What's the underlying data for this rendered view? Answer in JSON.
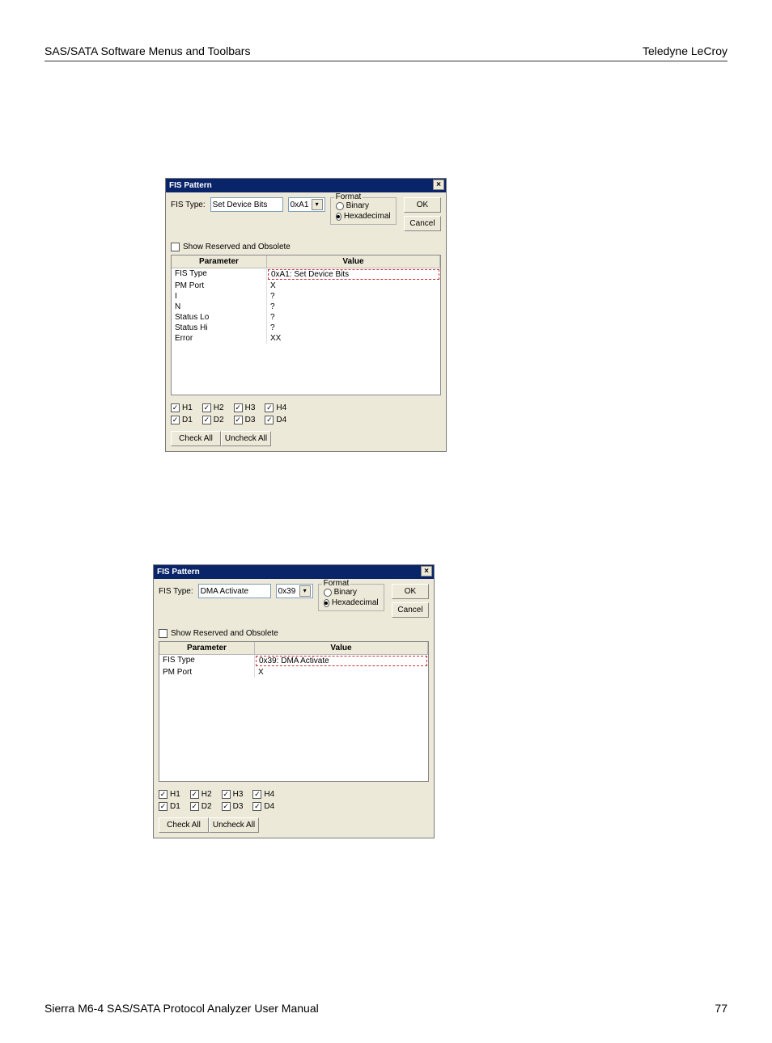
{
  "header": {
    "left": "SAS/SATA Software Menus and Toolbars",
    "right": "Teledyne LeCroy"
  },
  "footer": {
    "left": "Sierra M6-4 SAS/SATA Protocol Analyzer User Manual",
    "right": "77"
  },
  "dialog1": {
    "title": "FIS Pattern",
    "fis_type_label": "FIS Type:",
    "fis_type_value": "Set Device Bits",
    "hex_value": "0xA1",
    "format": {
      "legend": "Format",
      "binary": "Binary",
      "hex": "Hexadecimal",
      "selected": "hex"
    },
    "ok": "OK",
    "cancel": "Cancel",
    "show_reserved": "Show Reserved and Obsolete",
    "columns": {
      "param": "Parameter",
      "value": "Value"
    },
    "rows": [
      {
        "param": "FIS Type",
        "value": "0xA1: Set Device Bits",
        "dashed": true
      },
      {
        "param": "PM Port",
        "value": "X"
      },
      {
        "param": "I",
        "value": "?"
      },
      {
        "param": "N",
        "value": "?"
      },
      {
        "param": "Status Lo",
        "value": "?"
      },
      {
        "param": "Status Hi",
        "value": "?"
      },
      {
        "param": "Error",
        "value": "XX"
      }
    ],
    "hd": {
      "H1": "H1",
      "H2": "H2",
      "H3": "H3",
      "H4": "H4",
      "D1": "D1",
      "D2": "D2",
      "D3": "D3",
      "D4": "D4"
    },
    "check_all": "Check All",
    "uncheck_all": "Uncheck All"
  },
  "dialog2": {
    "title": "FIS Pattern",
    "fis_type_label": "FIS Type:",
    "fis_type_value": "DMA Activate",
    "hex_value": "0x39",
    "format": {
      "legend": "Format",
      "binary": "Binary",
      "hex": "Hexadecimal",
      "selected": "hex"
    },
    "ok": "OK",
    "cancel": "Cancel",
    "show_reserved": "Show Reserved and Obsolete",
    "columns": {
      "param": "Parameter",
      "value": "Value"
    },
    "rows": [
      {
        "param": "FIS Type",
        "value": "0x39: DMA Activate",
        "dashed": true
      },
      {
        "param": "PM Port",
        "value": "X"
      }
    ],
    "hd": {
      "H1": "H1",
      "H2": "H2",
      "H3": "H3",
      "H4": "H4",
      "D1": "D1",
      "D2": "D2",
      "D3": "D3",
      "D4": "D4"
    },
    "check_all": "Check All",
    "uncheck_all": "Uncheck All"
  }
}
